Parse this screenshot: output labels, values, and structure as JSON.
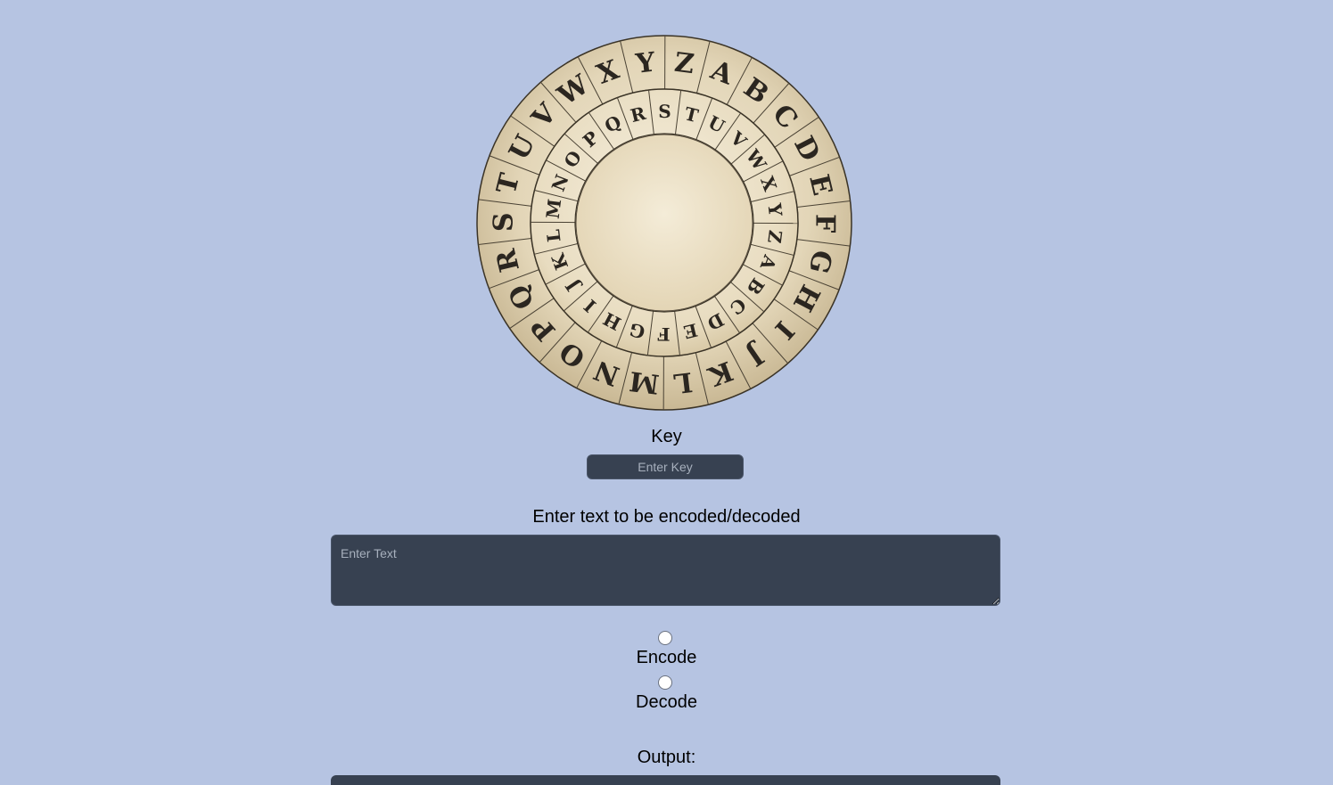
{
  "wheel": {
    "outer_letters": [
      "A",
      "B",
      "C",
      "D",
      "E",
      "F",
      "G",
      "H",
      "I",
      "J",
      "K",
      "L",
      "M",
      "N",
      "O",
      "P",
      "Q",
      "R",
      "S",
      "T",
      "U",
      "V",
      "W",
      "X",
      "Y",
      "Z"
    ],
    "inner_letters": [
      "A",
      "B",
      "C",
      "D",
      "E",
      "F",
      "G",
      "H",
      "I",
      "J",
      "K",
      "L",
      "M",
      "N",
      "O",
      "P",
      "Q",
      "R",
      "S",
      "T",
      "U",
      "V",
      "W",
      "X",
      "Y",
      "Z"
    ]
  },
  "key": {
    "label": "Key",
    "placeholder": "Enter Key"
  },
  "text": {
    "label": "Enter text to be encoded/decoded",
    "placeholder": "Enter Text"
  },
  "mode": {
    "encode_label": "Encode",
    "decode_label": "Decode"
  },
  "output": {
    "label": "Output:"
  }
}
